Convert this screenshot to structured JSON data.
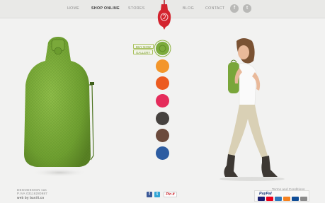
{
  "nav": {
    "items": [
      {
        "label": "HOME"
      },
      {
        "label": "SHOP ONLINE"
      },
      {
        "label": "STORES"
      },
      {
        "label": "BLOG"
      },
      {
        "label": "CONTACT"
      }
    ],
    "social": {
      "facebook": "f",
      "twitter": "t"
    }
  },
  "product": {
    "buy_now_label": "BUY NOW",
    "gallery_label": "GALLERY",
    "selected_color": "green",
    "color_options": [
      {
        "name": "green",
        "hex": "#7cab3c"
      },
      {
        "name": "orange",
        "hex": "#f3962b"
      },
      {
        "name": "red-orange",
        "hex": "#ec5b20"
      },
      {
        "name": "pink",
        "hex": "#e52c5b"
      },
      {
        "name": "dark-grey",
        "hex": "#46423f"
      },
      {
        "name": "brown",
        "hex": "#6b4a3c"
      },
      {
        "name": "blue",
        "hex": "#2d5ca1"
      }
    ]
  },
  "footer": {
    "company_name": "DEGODESIGN sas",
    "vat": "P.IVA 03116280987",
    "web_credit": "web by basili.co",
    "share": {
      "facebook": "f",
      "twitter": "t",
      "pinit": "Pin it"
    },
    "terms_label": "Terms and Conditions",
    "paypal_label": "PayPal"
  },
  "colors": {
    "accent_green": "#7cab3c",
    "logo_red": "#d3232e",
    "nav_active": "#3a3a3a"
  },
  "icons": [
    "facebook-icon",
    "twitter-icon",
    "pinit-icon",
    "paypal-icon"
  ]
}
